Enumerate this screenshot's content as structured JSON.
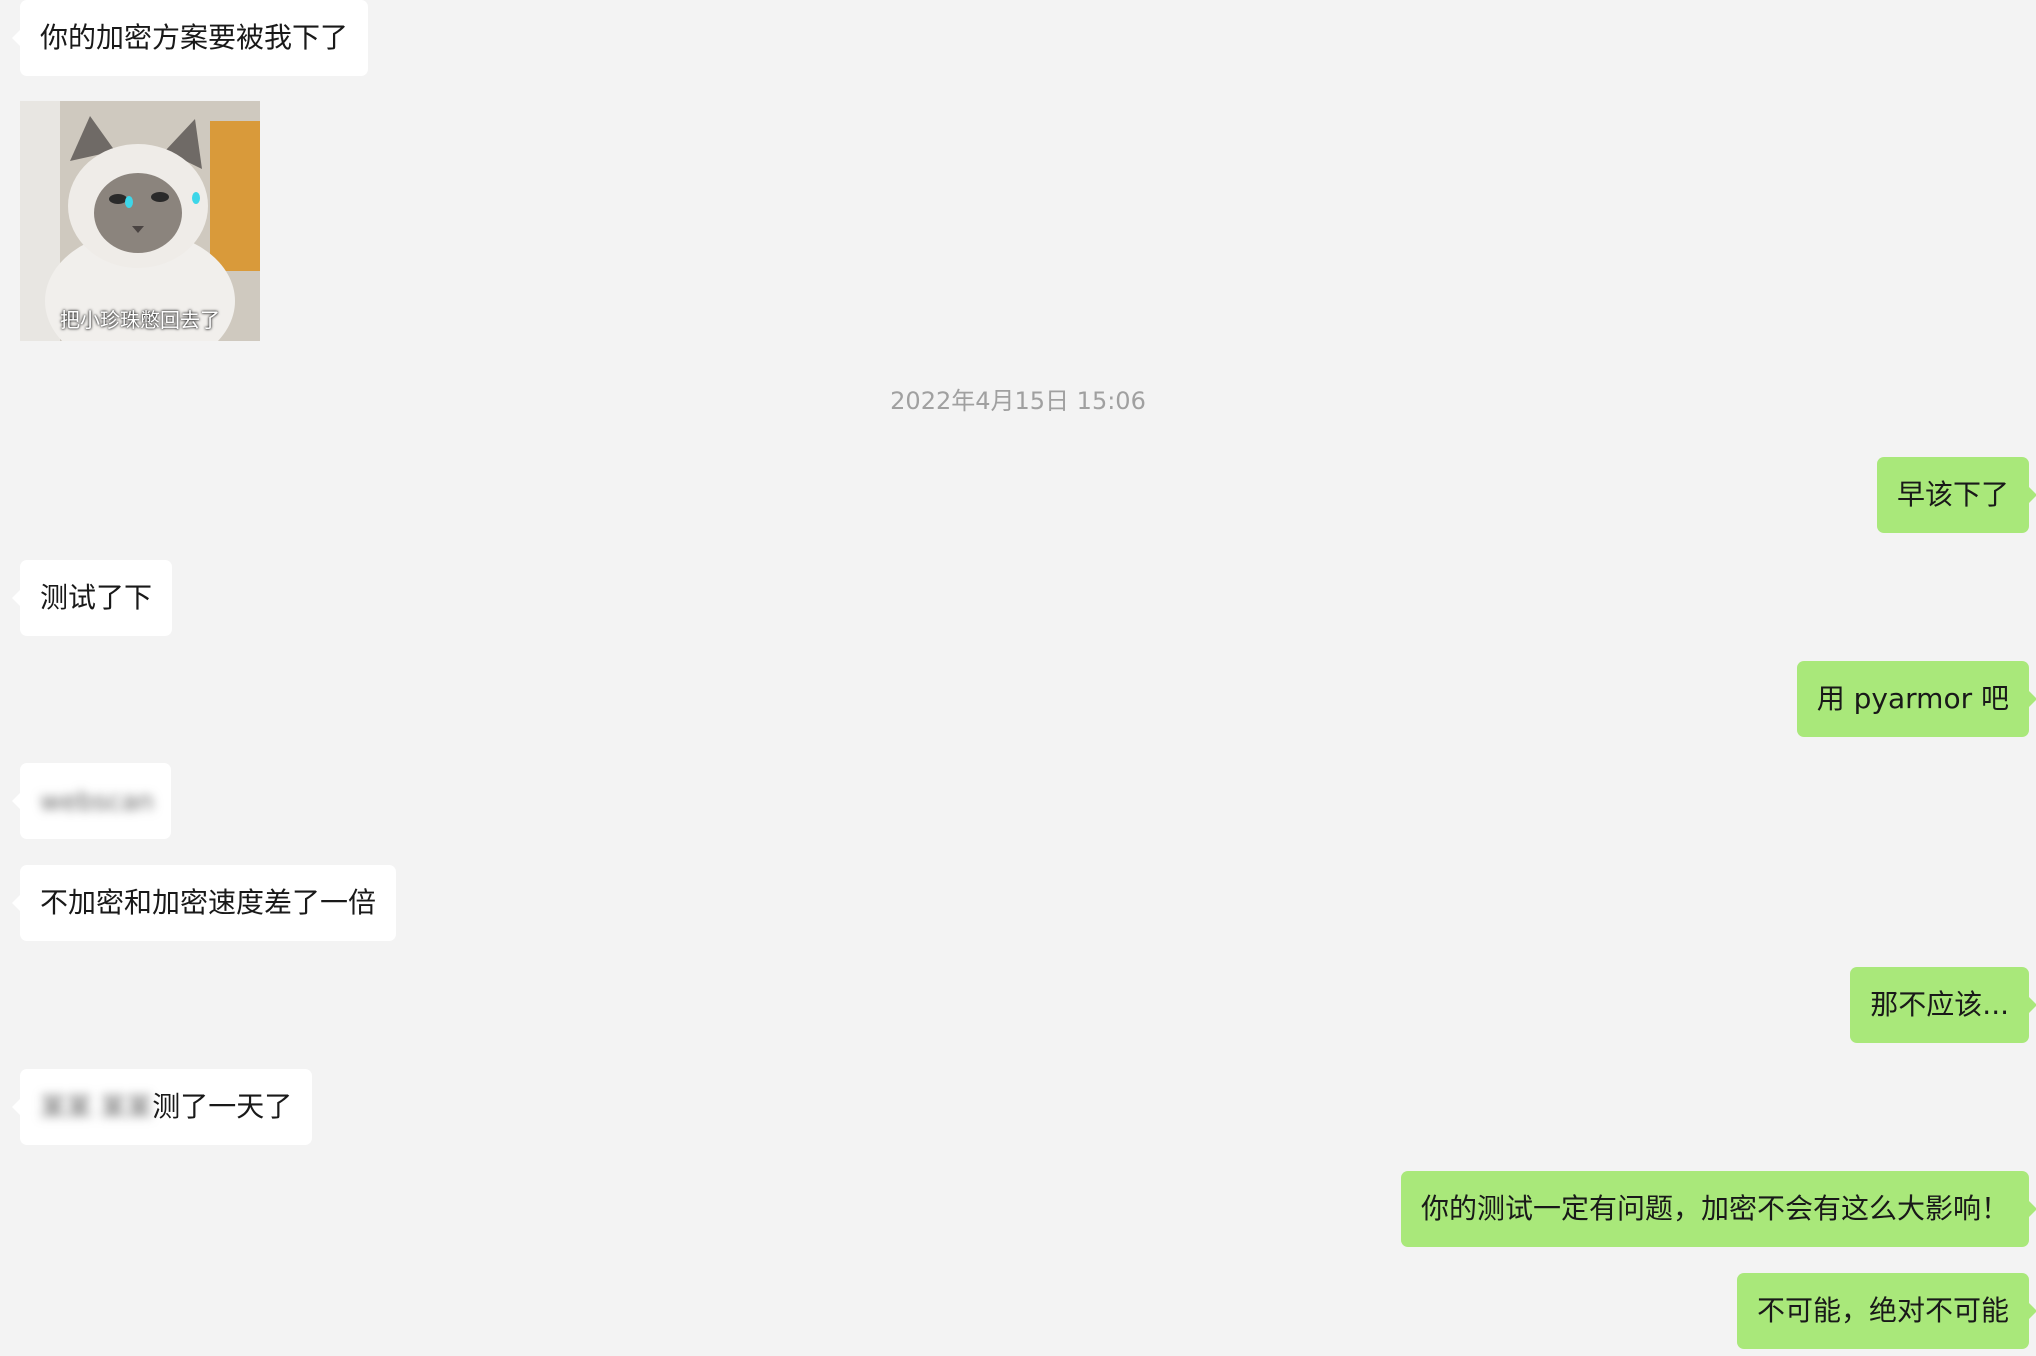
{
  "messages": {
    "m1": "你的加密方案要被我下了",
    "sticker_caption": "把小珍珠憋回去了",
    "timestamp": "2022年4月15日 15:06",
    "m2": "早该下了",
    "m3": "测试了下",
    "m4": "用 pyarmor 吧",
    "m5_blurred": "webscan",
    "m6": "不加密和加密速度差了一倍",
    "m7": "那不应该...",
    "m8_blurred": "某某 某某",
    "m8_suffix": "测了一天了",
    "m9": "你的测试一定有问题，加密不会有这么大影响！",
    "m10": "不可能，绝对不可能"
  },
  "colors": {
    "background": "#f3f3f3",
    "incoming_bubble": "#ffffff",
    "outgoing_bubble": "#a9e87a",
    "timestamp_text": "#a0a0a0"
  }
}
